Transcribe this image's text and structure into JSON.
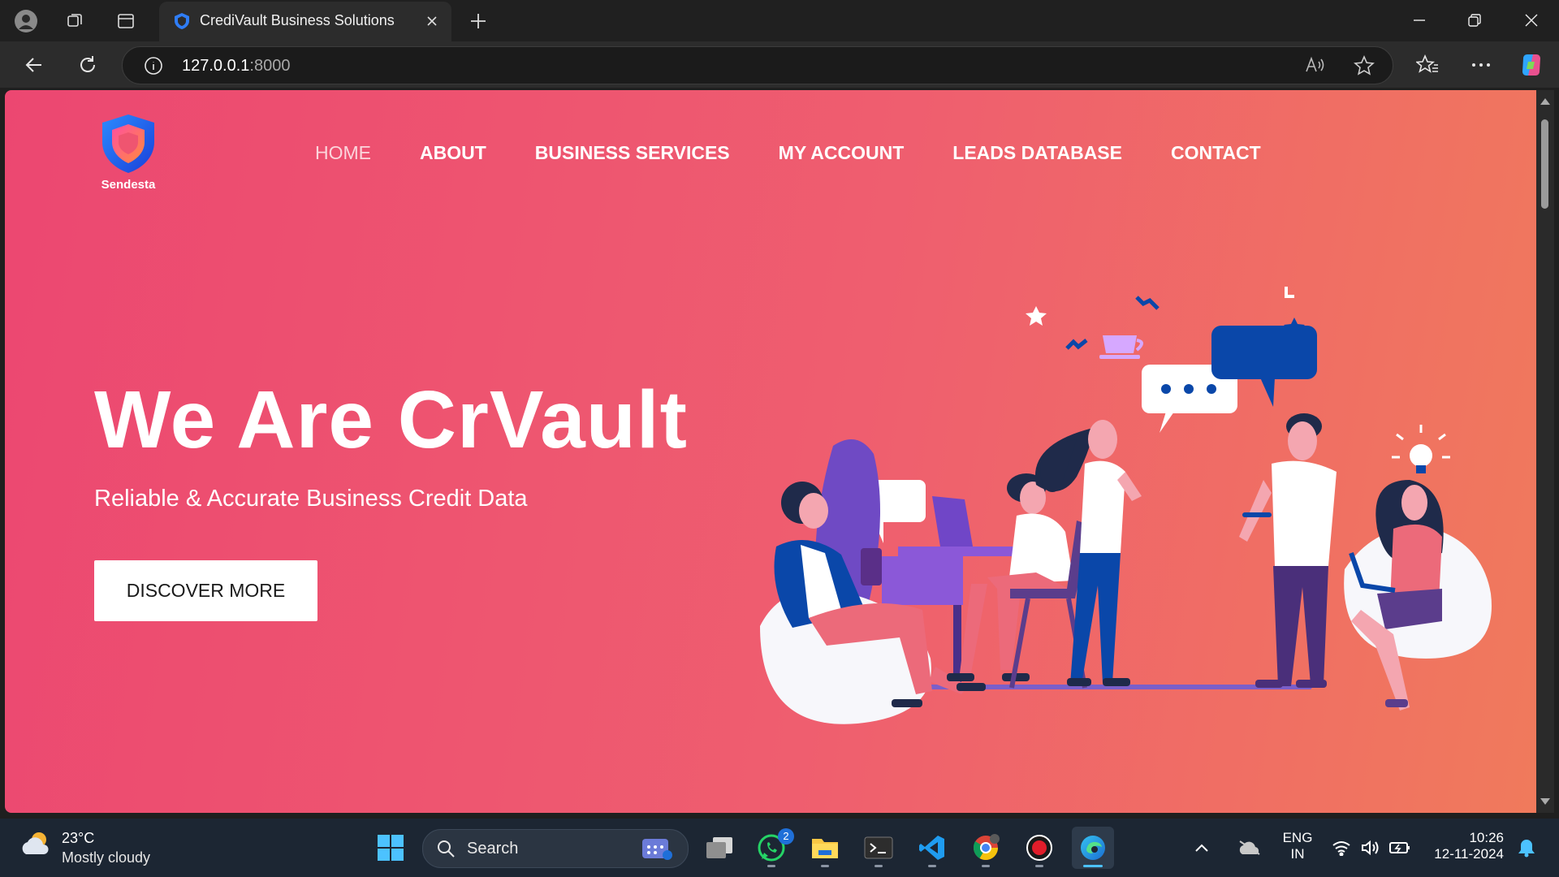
{
  "browser": {
    "tab_title": "CrediVault Business Solutions",
    "url_host": "127.0.0.1",
    "url_port": ":8000"
  },
  "site": {
    "logo_text": "Sendesta",
    "nav": [
      {
        "label": "HOME",
        "active": true
      },
      {
        "label": "ABOUT"
      },
      {
        "label": "BUSINESS SERVICES"
      },
      {
        "label": "MY ACCOUNT"
      },
      {
        "label": "LEADS DATABASE"
      },
      {
        "label": "CONTACT"
      }
    ],
    "hero_title": "We Are CrVault",
    "hero_subtitle": "Reliable & Accurate Business Credit Data",
    "cta_label": "DISCOVER MORE"
  },
  "taskbar": {
    "weather_temp": "23°C",
    "weather_desc": "Mostly cloudy",
    "search_label": "Search",
    "whatsapp_badge": "2",
    "lang_line1": "ENG",
    "lang_line2": "IN",
    "time": "10:26",
    "date": "12-11-2024"
  },
  "colors": {
    "page_gradient_start": "#ec4771",
    "page_gradient_end": "#f07a5c",
    "accent_blue": "#0a47a9",
    "taskbar_bg": "#1c2633"
  }
}
